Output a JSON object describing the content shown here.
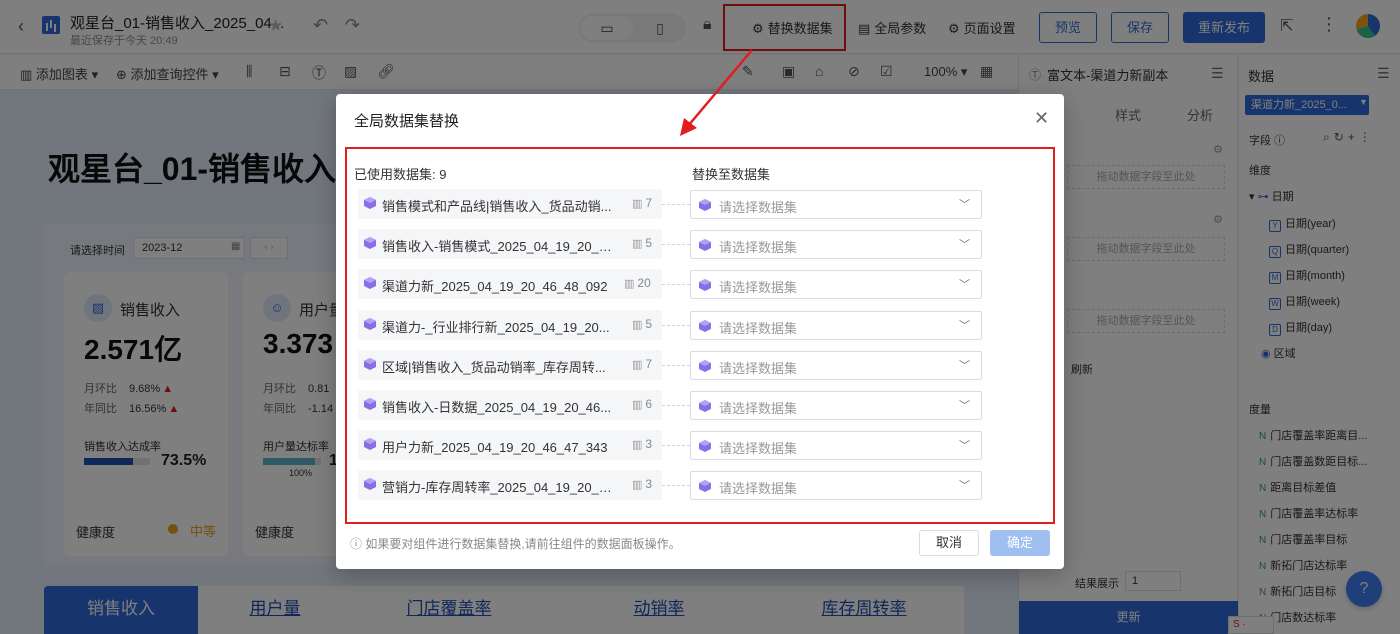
{
  "header": {
    "back": "‹",
    "title": "观星台_01-销售收入_2025_04...",
    "subtitle": "最近保存于今天 20:49",
    "links": {
      "replace_dataset": "替换数据集",
      "global_params": "全局参数",
      "page_settings": "页面设置"
    },
    "buttons": {
      "preview": "预览",
      "save": "保存",
      "republish": "重新发布"
    }
  },
  "toolbar": {
    "add_chart": "添加图表",
    "add_query": "添加查询控件",
    "zoom": "100%"
  },
  "dashboard": {
    "title": "观星台_01-销售收入",
    "filter": {
      "label": "请选择时间",
      "value": "2023-12"
    },
    "kpis": [
      {
        "name": "销售收入",
        "value": "2.571亿",
        "mom_label": "月环比",
        "mom_value": "9.68%",
        "yoy_label": "年同比",
        "yoy_value": "16.56%",
        "target_label": "销售收入达成率",
        "target_pct": "73.5%",
        "target_fraction": 0.735,
        "health_label": "健康度",
        "health_level": "中等"
      },
      {
        "name": "用户量",
        "value": "3.373",
        "mom_label": "月环比",
        "mom_value": "0.81",
        "yoy_label": "年同比",
        "yoy_value": "-1.14",
        "target_label": "用户量达标率",
        "target_pct": "1",
        "target_fraction": 0.9,
        "small_label": "100%",
        "health_label": "健康度"
      }
    ],
    "tabs": [
      "销售收入",
      "用户量",
      "门店覆盖率",
      "动销率",
      "库存周转率"
    ]
  },
  "prop_panel": {
    "title": "富文本-渠道力新副本",
    "tabs": [
      "样式",
      "分析"
    ],
    "drop_hint": "拖动数据字段至此处",
    "refresh_label": "刷新",
    "result_label": "结果展示",
    "result_value": "1",
    "update_button": "更新"
  },
  "data_panel": {
    "title": "数据",
    "dataset": "渠道力新_2025_0...",
    "fields_label": "字段",
    "dimension_label": "维度",
    "dimensions": [
      {
        "label": "日期",
        "badge": ""
      },
      {
        "label": "日期(year)",
        "badge": "Y"
      },
      {
        "label": "日期(quarter)",
        "badge": "Q"
      },
      {
        "label": "日期(month)",
        "badge": "M"
      },
      {
        "label": "日期(week)",
        "badge": "W"
      },
      {
        "label": "日期(day)",
        "badge": "D"
      },
      {
        "label": "区域",
        "badge": ""
      }
    ],
    "measure_label": "度量",
    "measures": [
      "门店覆盖率距离目...",
      "门店覆盖数距目标...",
      "距离目标差值",
      "门店覆盖率达标率",
      "门店覆盖率目标",
      "新拓门店达标率",
      "新拓门店目标",
      "门店数达标率"
    ],
    "measure_icon": "N"
  },
  "modal": {
    "title": "全局数据集替换",
    "used_label": "已使用数据集: 9",
    "replace_label": "替换至数据集",
    "datasets": [
      {
        "name": "销售模式和产品线|销售收入_货品动销...",
        "count": "7"
      },
      {
        "name": "销售收入-销售模式_2025_04_19_20_4...",
        "count": "5"
      },
      {
        "name": "渠道力新_2025_04_19_20_46_48_092",
        "count": "20"
      },
      {
        "name": "渠道力-_行业排行新_2025_04_19_20...",
        "count": "5"
      },
      {
        "name": "区域|销售收入_货品动销率_库存周转...",
        "count": "7"
      },
      {
        "name": "销售收入-日数据_2025_04_19_20_46...",
        "count": "6"
      },
      {
        "name": "用户力新_2025_04_19_20_46_47_343",
        "count": "3"
      },
      {
        "name": "营销力-库存周转率_2025_04_19_20_4...",
        "count": "3"
      }
    ],
    "select_placeholder": "请选择数据集",
    "tip": "ⓘ 如果要对组件进行数据集替换,请前往组件的数据面板操作。",
    "cancel": "取消",
    "confirm": "确定"
  },
  "colors": {
    "accent": "#2f6bd9",
    "highlight": "#e11d1d",
    "warning": "#e6a417"
  }
}
